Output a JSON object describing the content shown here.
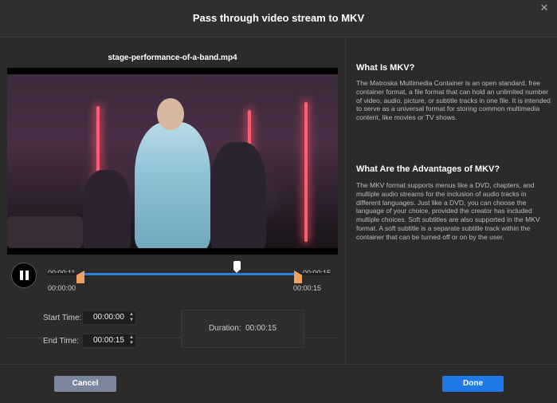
{
  "dialog": {
    "title": "Pass through video stream to MKV",
    "close_icon": "close-icon"
  },
  "player": {
    "filename": "stage-performance-of-a-band.mp4",
    "current_time": "00:00:11",
    "total_time": "00:00:15",
    "range_start": "00:00:00",
    "range_end": "00:00:15",
    "playhead_position_fraction": 0.73,
    "playhead_position_percent": 73,
    "state_icon": "pause-icon",
    "accent_color": "#2f7de1",
    "handle_color": "#f0a060"
  },
  "trim": {
    "start_label": "Start Time:",
    "start_value": "00:00:00",
    "end_label": "End Time:",
    "end_value": "00:00:15",
    "duration_label": "Duration:",
    "duration_value": "00:00:15"
  },
  "info": {
    "heading1": "What Is MKV?",
    "para1": "The Matroska Multimedia Container is an open standard, free container format, a file format that can hold an unlimited number of video, audio, picture, or subtitle tracks in one file. It is intended to serve as a universal format for storing common multimedia content, like movies or TV shows.",
    "heading2": "What Are the Advantages of MKV?",
    "para2": "The MKV format supports menus like a DVD, chapters, and multiple audio streams for the inclusion of audio tracks in different languages. Just like a DVD, you can choose the language of your choice, provided the creator has included multiple choices. Soft subtitles are also supported in the MKV format. A soft subtitle is a separate subtitle track within the container that can be turned off or on by the user."
  },
  "buttons": {
    "cancel": "Cancel",
    "done": "Done",
    "done_color": "#1f7ae8"
  }
}
